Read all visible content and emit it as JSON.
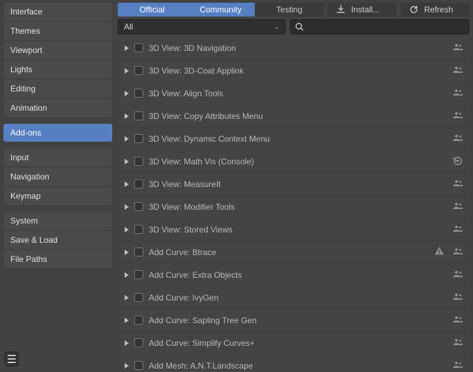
{
  "sidebar": {
    "groups": [
      [
        "Interface",
        "Themes",
        "Viewport",
        "Lights",
        "Editing",
        "Animation"
      ],
      [
        "Add-ons"
      ],
      [
        "Input",
        "Navigation",
        "Keymap"
      ],
      [
        "System",
        "Save & Load",
        "File Paths"
      ]
    ],
    "active": "Add-ons"
  },
  "toolbar": {
    "tabs": [
      "Official",
      "Community",
      "Testing"
    ],
    "active_tabs": [
      "Official",
      "Community"
    ],
    "install_label": "Install...",
    "refresh_label": "Refresh"
  },
  "filter": {
    "category": "All",
    "search_value": ""
  },
  "addons": [
    {
      "name": "3D View: 3D Navigation",
      "icons": [
        "community"
      ]
    },
    {
      "name": "3D View: 3D-Coat Applink",
      "icons": [
        "community"
      ]
    },
    {
      "name": "3D View: Align Tools",
      "icons": [
        "community"
      ]
    },
    {
      "name": "3D View: Copy Attributes Menu",
      "icons": [
        "community"
      ]
    },
    {
      "name": "3D View: Dynamic Context Menu",
      "icons": [
        "community"
      ]
    },
    {
      "name": "3D View: Math Vis (Console)",
      "icons": [
        "blender"
      ]
    },
    {
      "name": "3D View: MeasureIt",
      "icons": [
        "community"
      ]
    },
    {
      "name": "3D View: Modifier Tools",
      "icons": [
        "community"
      ]
    },
    {
      "name": "3D View: Stored Views",
      "icons": [
        "community"
      ]
    },
    {
      "name": "Add Curve: Btrace",
      "icons": [
        "warning",
        "community"
      ]
    },
    {
      "name": "Add Curve: Extra Objects",
      "icons": [
        "community"
      ]
    },
    {
      "name": "Add Curve: IvyGen",
      "icons": [
        "community"
      ]
    },
    {
      "name": "Add Curve: Sapling Tree Gen",
      "icons": [
        "community"
      ]
    },
    {
      "name": "Add Curve: Simplify Curves+",
      "icons": [
        "community"
      ]
    },
    {
      "name": "Add Mesh: A.N.T.Landscape",
      "icons": [
        "community"
      ]
    }
  ]
}
